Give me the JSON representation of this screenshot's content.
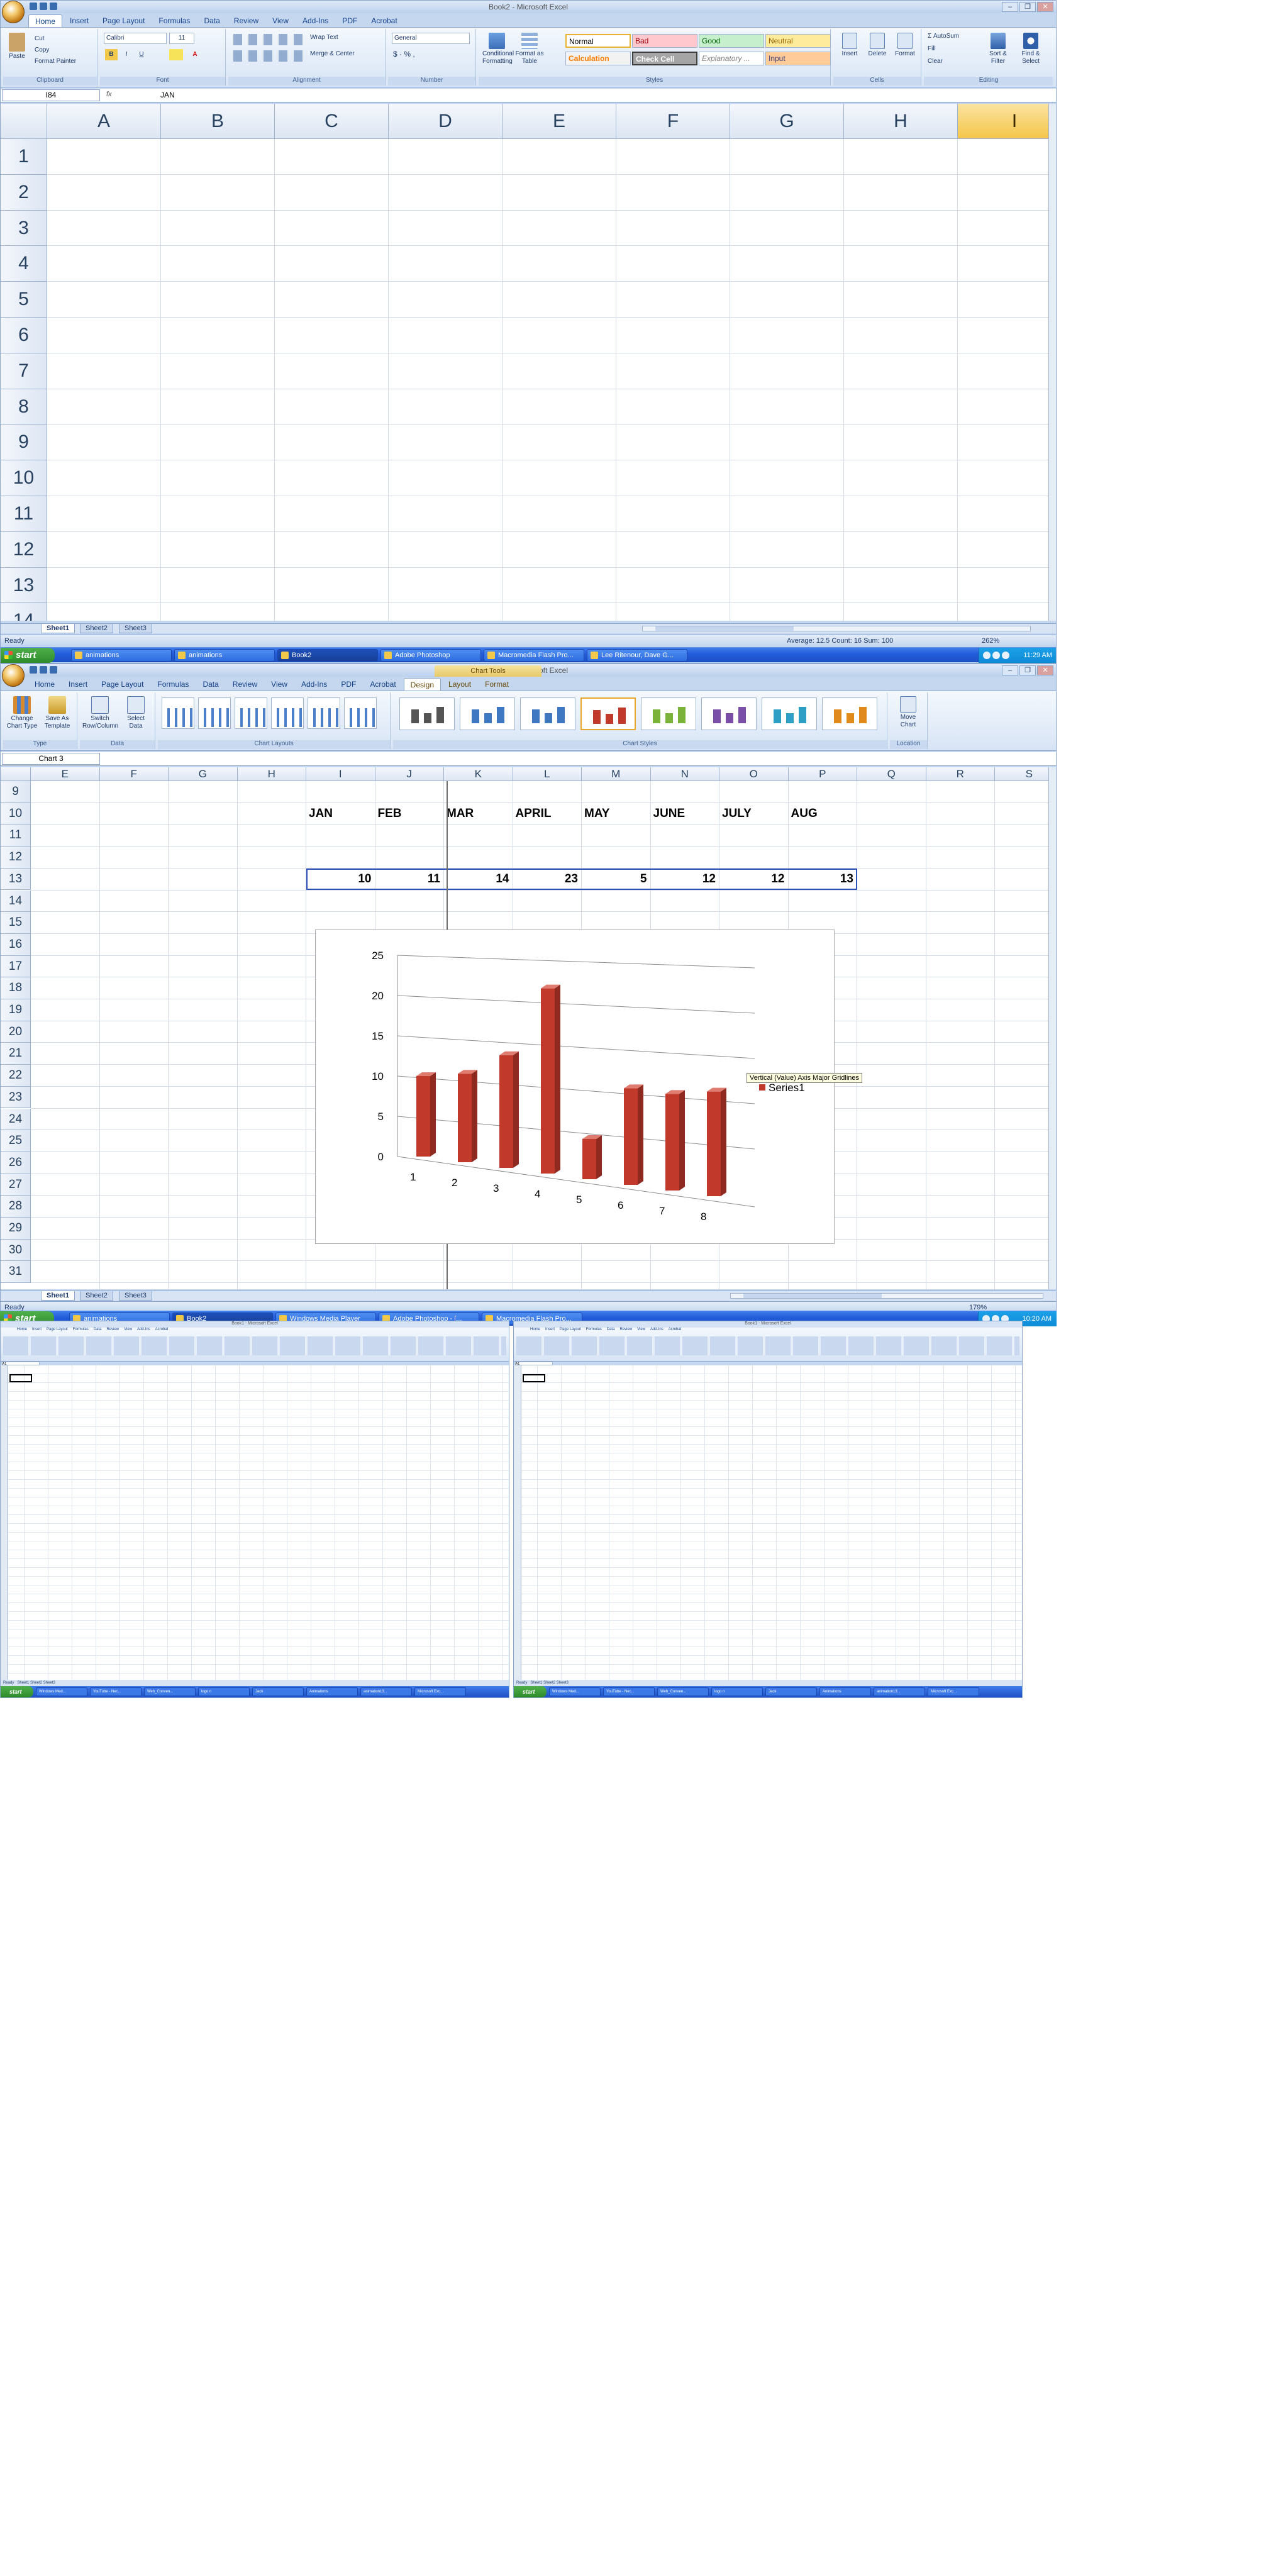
{
  "window1": {
    "title": "Book2 - Microsoft Excel",
    "tabs": [
      "Home",
      "Insert",
      "Page Layout",
      "Formulas",
      "Data",
      "Review",
      "View",
      "Add-Ins",
      "PDF",
      "Acrobat"
    ],
    "clipboard": {
      "paste": "Paste",
      "cut": "Cut",
      "copy": "Copy",
      "format_painter": "Format Painter",
      "label": "Clipboard"
    },
    "font": {
      "name": "Calibri",
      "size": "11",
      "label": "Font"
    },
    "alignment": {
      "wrap": "Wrap Text",
      "merge": "Merge & Center",
      "label": "Alignment"
    },
    "number": {
      "format": "General",
      "label": "Number"
    },
    "styles": {
      "conditional": "Conditional Formatting",
      "format_table": "Format as Table",
      "normal": "Normal",
      "bad": "Bad",
      "good": "Good",
      "neutral": "Neutral",
      "calculation": "Calculation",
      "check_cell": "Check Cell",
      "explanatory": "Explanatory ...",
      "input": "Input",
      "label": "Styles"
    },
    "cells": {
      "insert": "Insert",
      "delete": "Delete",
      "format": "Format",
      "label": "Cells"
    },
    "editing": {
      "autosum": "AutoSum",
      "fill": "Fill",
      "clear": "Clear",
      "sort": "Sort & Filter",
      "find": "Find & Select",
      "label": "Editing"
    },
    "name_box": "I84",
    "formula": "JAN",
    "fx": "fx",
    "columns": [
      "A",
      "B",
      "C",
      "D",
      "E",
      "F",
      "G",
      "H",
      "I"
    ],
    "rows": [
      "1",
      "2",
      "3",
      "4",
      "5",
      "6",
      "7",
      "8",
      "9",
      "10",
      "11",
      "12",
      "13",
      "14"
    ],
    "sheets": [
      "Sheet1",
      "Sheet2",
      "Sheet3"
    ],
    "status_left": "Ready",
    "status_right": "Average: 12.5    Count: 16    Sum: 100",
    "zoom": "262%"
  },
  "taskbar1": {
    "start": "start",
    "buttons": [
      "animations",
      "animations",
      "Book2",
      "Adobe Photoshop",
      "Macromedia Flash Pro...",
      "Lee Ritenour, Dave G..."
    ],
    "clock": "11:29 AM"
  },
  "window2": {
    "title": "Book2 - Microsoft Excel",
    "context_header": "Chart Tools",
    "tabs": [
      "Home",
      "Insert",
      "Page Layout",
      "Formulas",
      "Data",
      "Review",
      "View",
      "Add-Ins",
      "PDF",
      "Acrobat",
      "Design",
      "Layout",
      "Format"
    ],
    "type_group": {
      "change": "Change Chart Type",
      "save": "Save As Template",
      "label": "Type"
    },
    "data_group": {
      "switch": "Switch Row/Column",
      "select": "Select Data",
      "label": "Data"
    },
    "layouts_label": "Chart Layouts",
    "styles_label": "Chart Styles",
    "location": {
      "move": "Move Chart",
      "label": "Location"
    },
    "name_box": "Chart 3",
    "columns": [
      "E",
      "F",
      "G",
      "H",
      "I",
      "J",
      "K",
      "L",
      "M",
      "N",
      "O",
      "P",
      "Q",
      "R",
      "S"
    ],
    "rows": [
      "9",
      "10",
      "11",
      "12",
      "13",
      "14",
      "15",
      "16",
      "17",
      "18",
      "19",
      "20",
      "21",
      "22",
      "23",
      "24",
      "25",
      "26",
      "27",
      "28",
      "29",
      "30",
      "31"
    ],
    "months": [
      "JAN",
      "FEB",
      "MAR",
      "APRIL",
      "MAY",
      "JUNE",
      "JULY",
      "AUG"
    ],
    "values": [
      "10",
      "11",
      "14",
      "23",
      "5",
      "12",
      "12",
      "13"
    ],
    "sheets": [
      "Sheet1",
      "Sheet2",
      "Sheet3"
    ],
    "status_left": "Ready",
    "zoom": "179%",
    "tooltip": "Vertical (Value) Axis Major Gridlines"
  },
  "taskbar2": {
    "start": "start",
    "buttons": [
      "animations",
      "Book2",
      "Windows Media Player",
      "Adobe Photoshop - [...",
      "Macromedia Flash Pro..."
    ],
    "clock": "10:20 AM"
  },
  "chart_data": {
    "type": "bar",
    "categories": [
      "1",
      "2",
      "3",
      "4",
      "5",
      "6",
      "7",
      "8"
    ],
    "series": [
      {
        "name": "Series1",
        "values": [
          10,
          11,
          14,
          23,
          5,
          12,
          12,
          13
        ]
      }
    ],
    "yticks": [
      "0",
      "5",
      "10",
      "15",
      "20",
      "25"
    ],
    "ylim": [
      0,
      25
    ],
    "legend": "right",
    "grid": true,
    "color": "#c0392b"
  },
  "mini_left": {
    "title": "Book1 - Microsoft Excel",
    "tabs": [
      "Home",
      "Insert",
      "Page Layout",
      "Formulas",
      "Data",
      "Review",
      "View",
      "Add-Ins",
      "Acrobat"
    ],
    "name_box": "A1",
    "sheets": [
      "Sheet1",
      "Sheet2",
      "Sheet3"
    ],
    "status": "Ready",
    "taskbar": [
      "Windows Med...",
      "YouTube - Nec...",
      "Web_Conven...",
      "logo n",
      "Jack",
      "Animations",
      "animation13...",
      "Microsoft Exc..."
    ]
  },
  "mini_right": {
    "title": "Book1 - Microsoft Excel",
    "tabs": [
      "Home",
      "Insert",
      "Page Layout",
      "Formulas",
      "Data",
      "Review",
      "View",
      "Add-Ins",
      "Acrobat"
    ],
    "name_box": "A1",
    "sheets": [
      "Sheet1",
      "Sheet2",
      "Sheet3"
    ],
    "status": "Ready",
    "taskbar": [
      "Windows Med...",
      "YouTube - Nec...",
      "Web_Conven...",
      "logo n",
      "Jack",
      "Animations",
      "animation13...",
      "Microsoft Exc..."
    ]
  }
}
